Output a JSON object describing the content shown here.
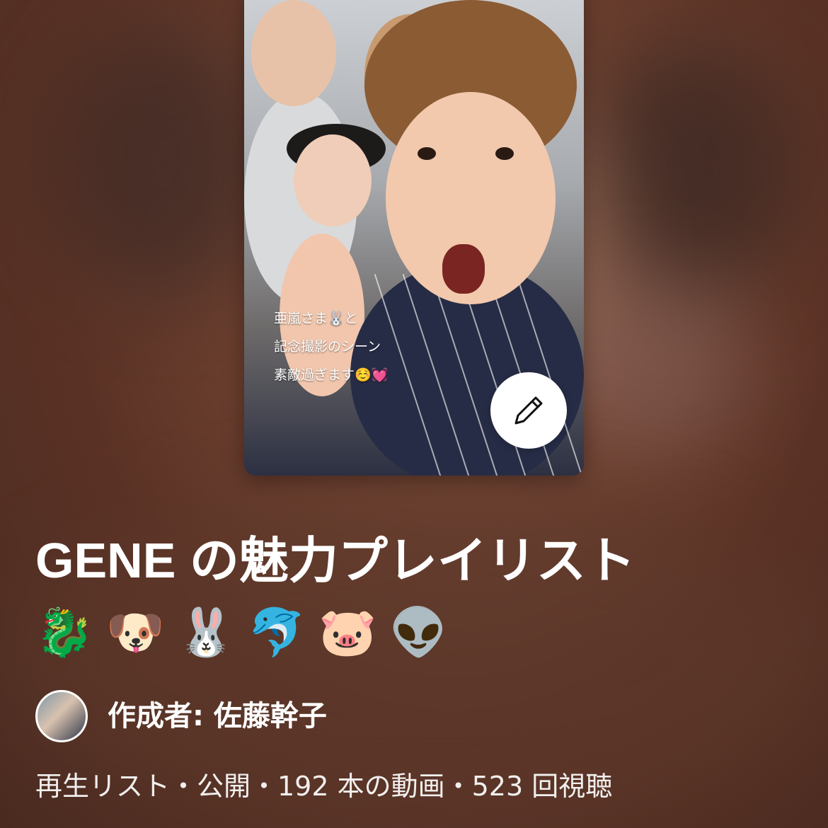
{
  "playlist": {
    "title": "GENE の魅力プレイリスト",
    "emojis": [
      "🐉",
      "🐶",
      "🐰",
      "🐬",
      "🐷",
      "👽"
    ],
    "author_label": "作成者: 佐藤幹子",
    "meta_line": "再生リスト・公開・192 本の動画・523 回視聴"
  },
  "thumbnail": {
    "caption_lines": [
      "亜嵐さま🐰と",
      "記念撮影のシーン",
      "素敵過ぎます☺️💓"
    ]
  },
  "icons": {
    "edit": "pencil-icon",
    "avatar": "author-avatar"
  },
  "colors": {
    "text": "#ffffff",
    "background": "#6f4231"
  }
}
